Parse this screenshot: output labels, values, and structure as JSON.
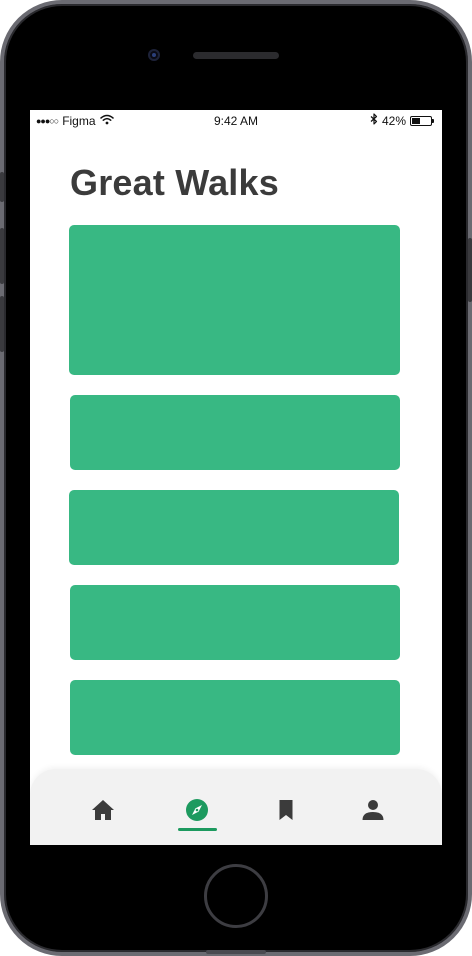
{
  "status_bar": {
    "signal": "●●●○○",
    "carrier": "Figma",
    "time": "9:42 AM",
    "battery_percent_label": "42%",
    "battery_level": 0.42
  },
  "page": {
    "title": "Great Walks"
  },
  "cards": [
    {
      "color": "#38b883"
    },
    {
      "color": "#38b883"
    },
    {
      "color": "#38b883"
    },
    {
      "color": "#38b883"
    },
    {
      "color": "#38b883"
    }
  ],
  "tab_bar": {
    "tabs": [
      {
        "icon": "home-icon",
        "active": false
      },
      {
        "icon": "compass-icon",
        "active": true
      },
      {
        "icon": "bookmark-icon",
        "active": false
      },
      {
        "icon": "profile-icon",
        "active": false
      }
    ],
    "active_color": "#1d9a5f",
    "icon_color": "#3b3b3b"
  }
}
